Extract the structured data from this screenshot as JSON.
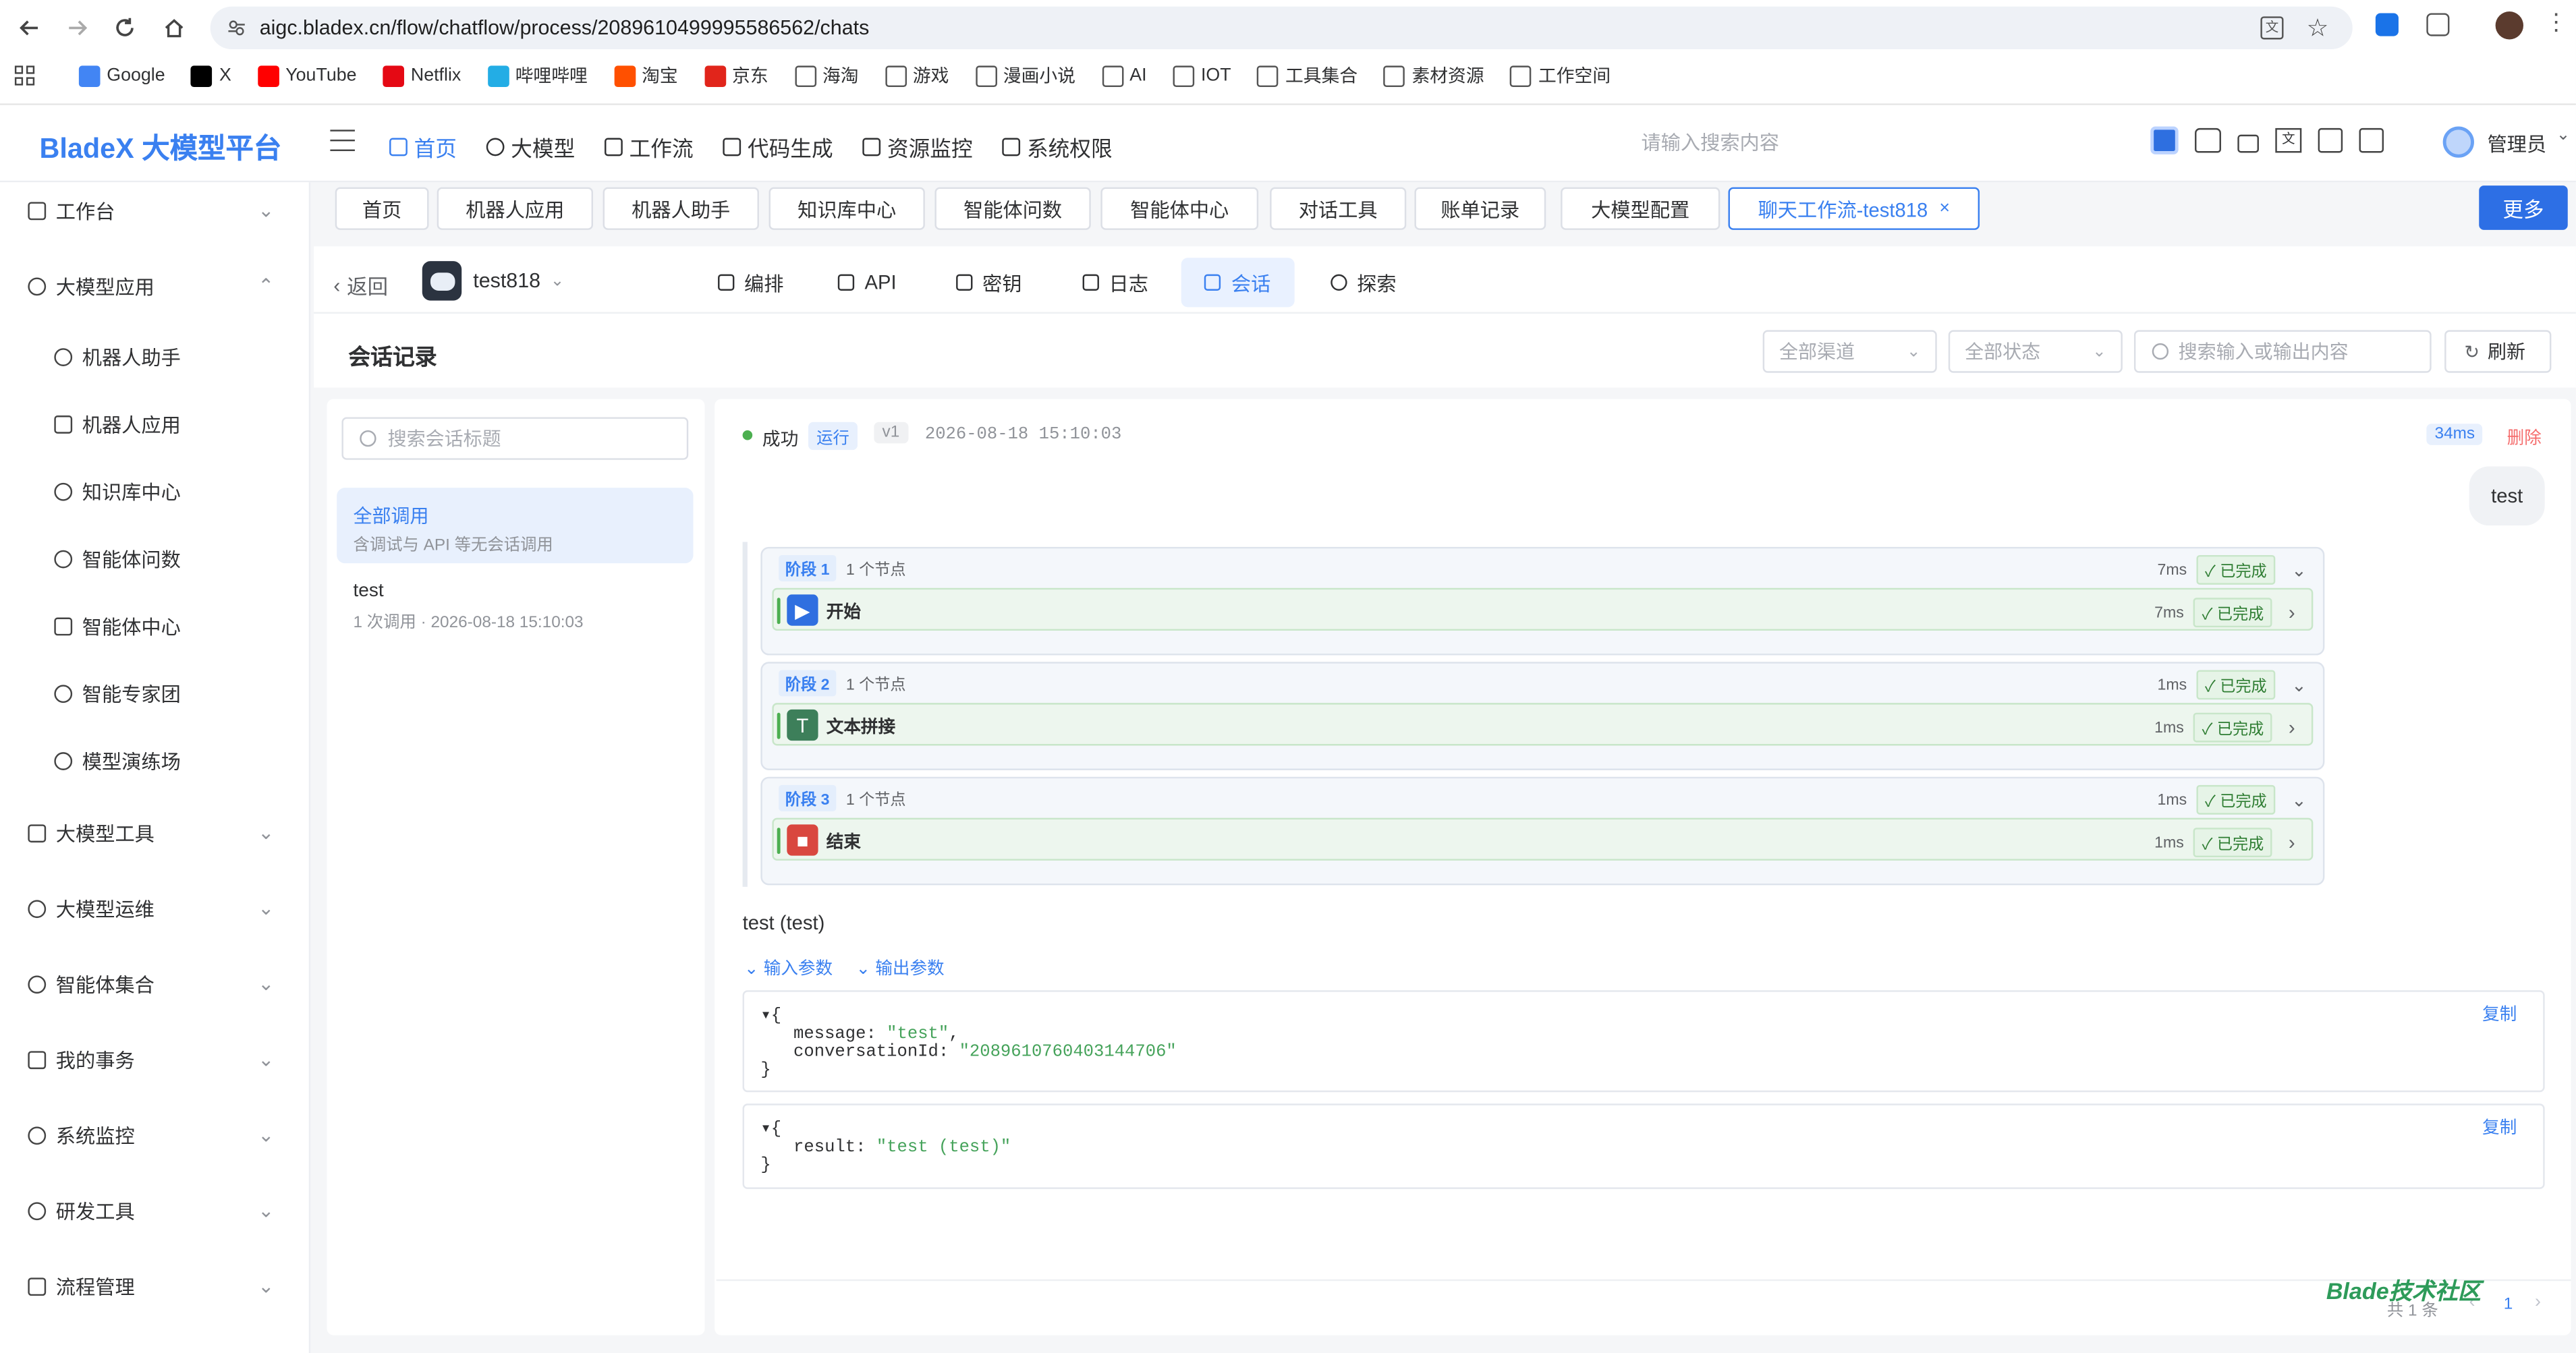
{
  "browser": {
    "url": "aigc.bladex.cn/flow/chatflow/process/2089610499995586562/chats",
    "bookmarks": [
      "Google",
      "X",
      "YouTube",
      "Netflix",
      "哔哩哔哩",
      "淘宝",
      "京东",
      "海淘",
      "游戏",
      "漫画小说",
      "AI",
      "IOT",
      "工具集合",
      "素材资源",
      "工作空间"
    ]
  },
  "header": {
    "logo": "BladeX 大模型平台",
    "nav": [
      "首页",
      "大模型",
      "工作流",
      "代码生成",
      "资源监控",
      "系统权限"
    ],
    "search_placeholder": "请输入搜索内容",
    "user": "管理员"
  },
  "sidebar": {
    "items": [
      {
        "label": "工作台"
      },
      {
        "label": "大模型应用"
      },
      {
        "label": "机器人助手"
      },
      {
        "label": "机器人应用"
      },
      {
        "label": "知识库中心"
      },
      {
        "label": "智能体问数"
      },
      {
        "label": "智能体中心"
      },
      {
        "label": "智能专家团"
      },
      {
        "label": "模型演练场"
      },
      {
        "label": "大模型工具"
      },
      {
        "label": "大模型运维"
      },
      {
        "label": "智能体集合"
      },
      {
        "label": "我的事务"
      },
      {
        "label": "系统监控"
      },
      {
        "label": "研发工具"
      },
      {
        "label": "流程管理"
      }
    ]
  },
  "tabs": [
    "首页",
    "机器人应用",
    "机器人助手",
    "知识库中心",
    "智能体问数",
    "智能体中心",
    "对话工具",
    "账单记录",
    "大模型配置",
    "聊天工作流-test818"
  ],
  "more_label": "更多",
  "subbar": {
    "back": "返回",
    "app_name": "test818",
    "nav": [
      "编排",
      "API",
      "密钥",
      "日志",
      "会话",
      "探索"
    ]
  },
  "filters": {
    "title": "会话记录",
    "channel": "全部渠道",
    "status": "全部状态",
    "search_placeholder": "搜索输入或输出内容",
    "refresh": "刷新"
  },
  "conversations": {
    "search_placeholder": "搜索会话标题",
    "items": [
      {
        "title": "全部调用",
        "sub": "含调试与 API 等无会话调用"
      },
      {
        "title": "test",
        "sub": "1 次调用 · 2026-08-18 15:10:03"
      }
    ]
  },
  "run": {
    "status": "成功",
    "tag": "运行",
    "version": "v1",
    "time": "2026-08-18 15:10:03",
    "duration": "34ms",
    "delete": "删除",
    "user_message": "test",
    "stages": [
      {
        "label": "阶段 1",
        "count": "1 个节点",
        "ms": "7ms",
        "state": "✓ 已完成",
        "node": {
          "name": "开始",
          "ms": "7ms",
          "state": "✓ 已完成",
          "icon": "play-icon",
          "color": "#2f6fe0"
        }
      },
      {
        "label": "阶段 2",
        "count": "1 个节点",
        "ms": "1ms",
        "state": "✓ 已完成",
        "node": {
          "name": "文本拼接",
          "ms": "1ms",
          "state": "✓ 已完成",
          "icon": "text-icon",
          "color": "#3d7f5a"
        }
      },
      {
        "label": "阶段 3",
        "count": "1 个节点",
        "ms": "1ms",
        "state": "✓ 已完成",
        "node": {
          "name": "结束",
          "ms": "1ms",
          "state": "✓ 已完成",
          "icon": "stop-icon",
          "color": "#d9473f"
        }
      }
    ],
    "output_text": "test (test)",
    "input_params_label": "输入参数",
    "output_params_label": "输出参数",
    "input_json": {
      "message": "\"test\"",
      "conversationId": "\"2089610760403144706\""
    },
    "output_json": {
      "result": "\"test (test)\""
    },
    "copy_label": "复制"
  },
  "footer": {
    "total": "共 1 条",
    "page": "1",
    "watermark": "Blade技术社区"
  },
  "colors": {
    "accent": "#3a80f0",
    "success": "#4caf50",
    "danger": "#f56c6c"
  }
}
